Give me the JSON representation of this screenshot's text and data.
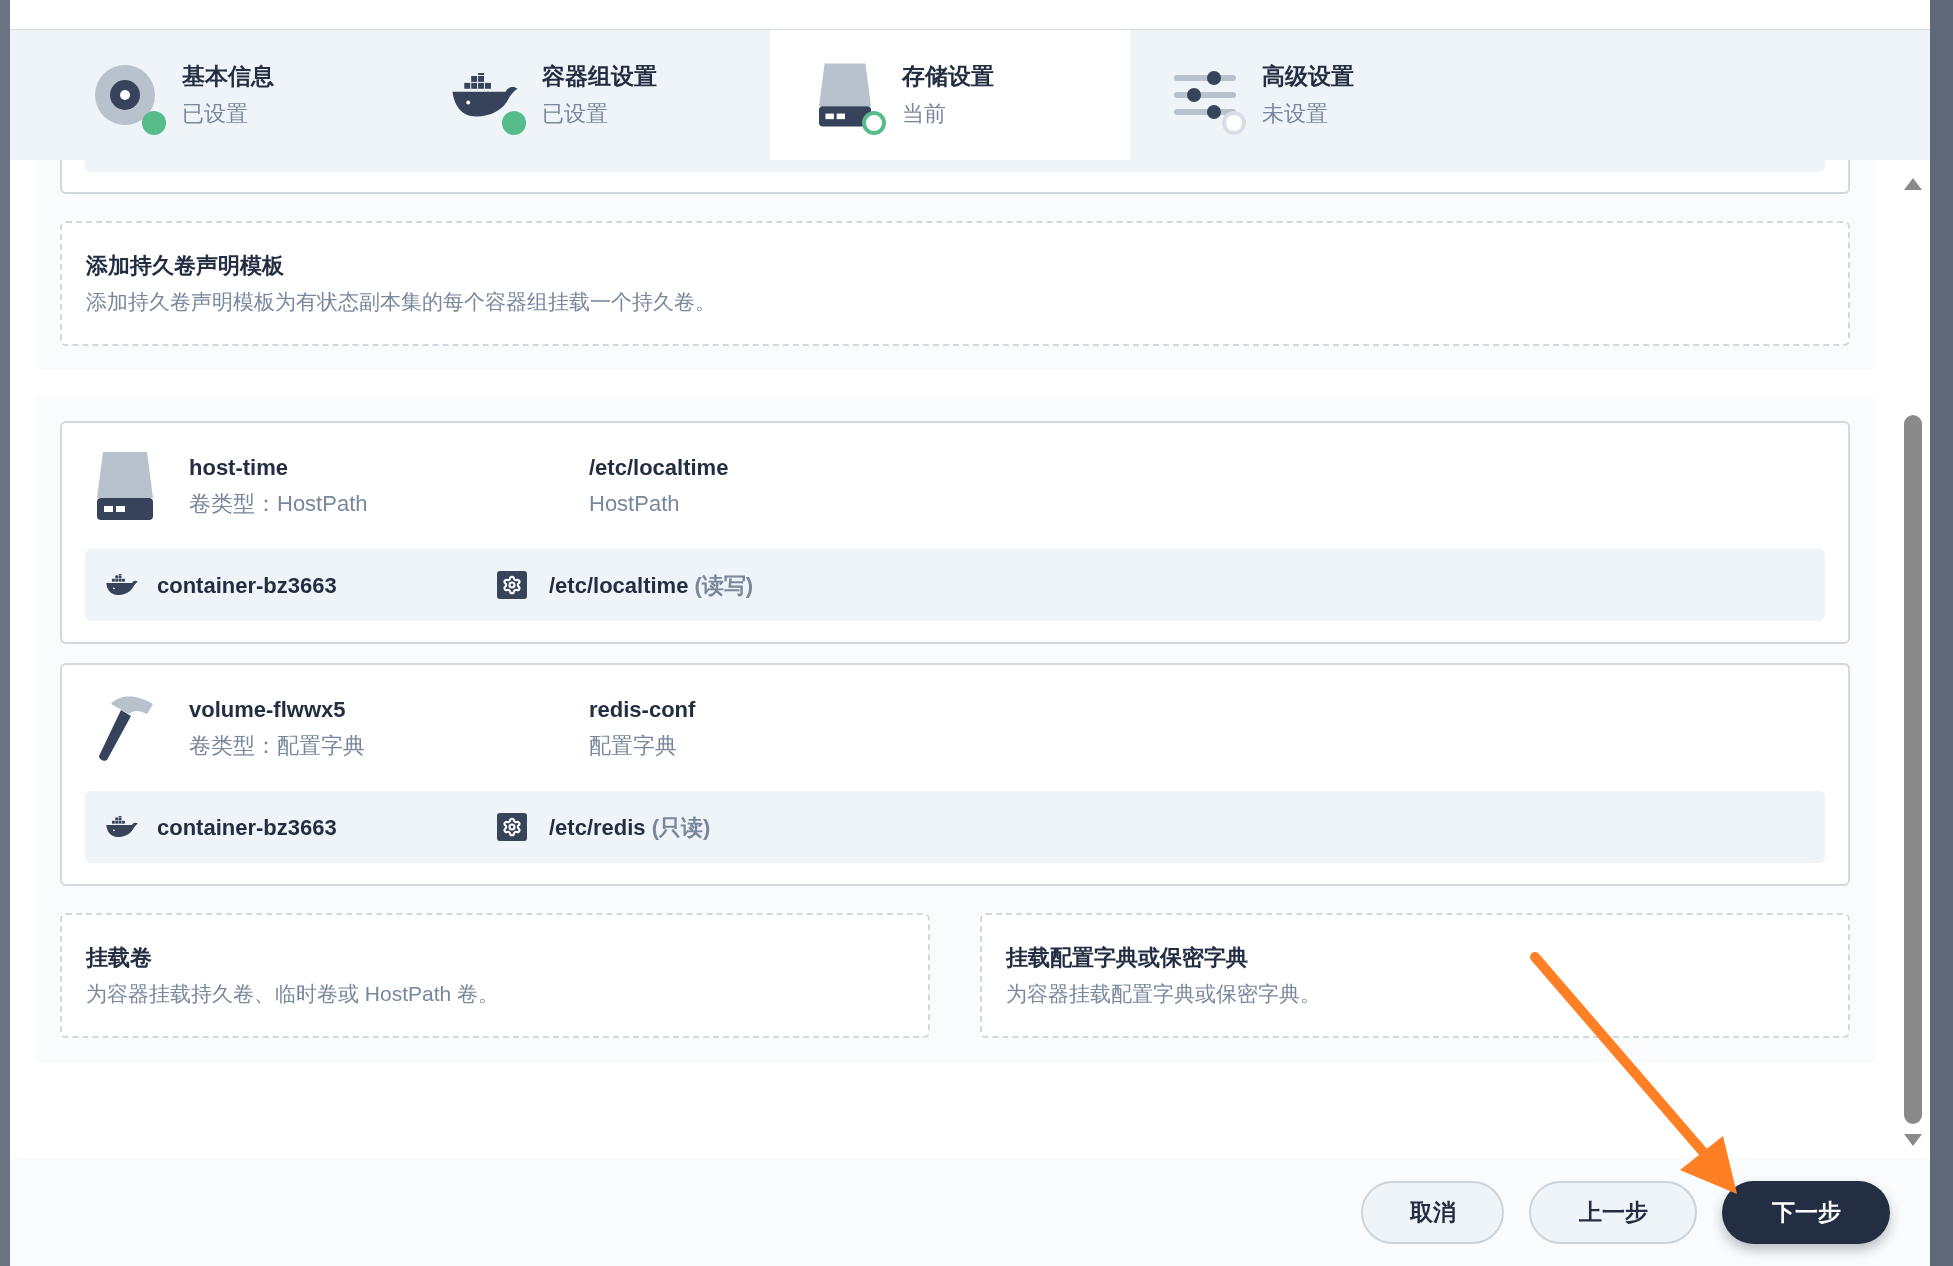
{
  "steps": [
    {
      "title": "基本信息",
      "status": "已设置",
      "completed": true,
      "selected": false,
      "kind": "disc"
    },
    {
      "title": "容器组设置",
      "status": "已设置",
      "completed": true,
      "selected": false,
      "kind": "whale"
    },
    {
      "title": "存储设置",
      "status": "当前",
      "completed": false,
      "selected": true,
      "kind": "drive"
    },
    {
      "title": "高级设置",
      "status": "未设置",
      "completed": false,
      "selected": false,
      "kind": "sliders"
    }
  ],
  "template": {
    "title": "添加持久卷声明模板",
    "description": "添加持久卷声明模板为有状态副本集的每个容器组挂载一个持久卷。"
  },
  "volumes": [
    {
      "kind": "drive",
      "name": "host-time",
      "type": "卷类型：HostPath",
      "source": "/etc/localtime",
      "source_type": "HostPath",
      "mounts": [
        {
          "container": "container-bz3663",
          "path": "/etc/localtime",
          "mode": "(读写)"
        }
      ]
    },
    {
      "kind": "hammer",
      "name": "volume-flwwx5",
      "type": "卷类型：配置字典",
      "source": "redis-conf",
      "source_type": "配置字典",
      "mounts": [
        {
          "container": "container-bz3663",
          "path": "/etc/redis",
          "mode": "(只读)"
        }
      ]
    }
  ],
  "actions": [
    {
      "title": "挂载卷",
      "description": "为容器挂载持久卷、临时卷或 HostPath 卷。"
    },
    {
      "title": "挂载配置字典或保密字典",
      "description": "为容器挂载配置字典或保密字典。"
    }
  ],
  "buttons": [
    {
      "label": "取消",
      "kind": "secondary"
    },
    {
      "label": "上一步",
      "kind": "secondary"
    },
    {
      "label": "下一步",
      "kind": "primary"
    }
  ]
}
